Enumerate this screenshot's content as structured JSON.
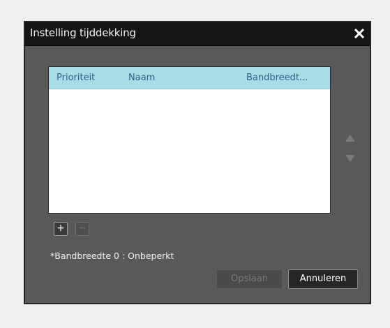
{
  "dialog": {
    "title": "Instelling tijddekking",
    "close_icon": "close-icon"
  },
  "list": {
    "columns": [
      "Prioriteit",
      "Naam",
      "Bandbreedt..."
    ],
    "rows": []
  },
  "controls": {
    "move_up_icon": "triangle-up-icon",
    "move_down_icon": "triangle-down-icon",
    "add_label": "+",
    "remove_label": "−"
  },
  "note": "*Bandbreedte 0 : Onbeperkt",
  "buttons": {
    "save_label": "Opslaan",
    "save_enabled": false,
    "cancel_label": "Annuleren"
  },
  "colors": {
    "dialog_bg": "#595959",
    "titlebar_bg": "#151515",
    "header_bg": "#a8dde6",
    "header_text": "#2f5e86"
  }
}
